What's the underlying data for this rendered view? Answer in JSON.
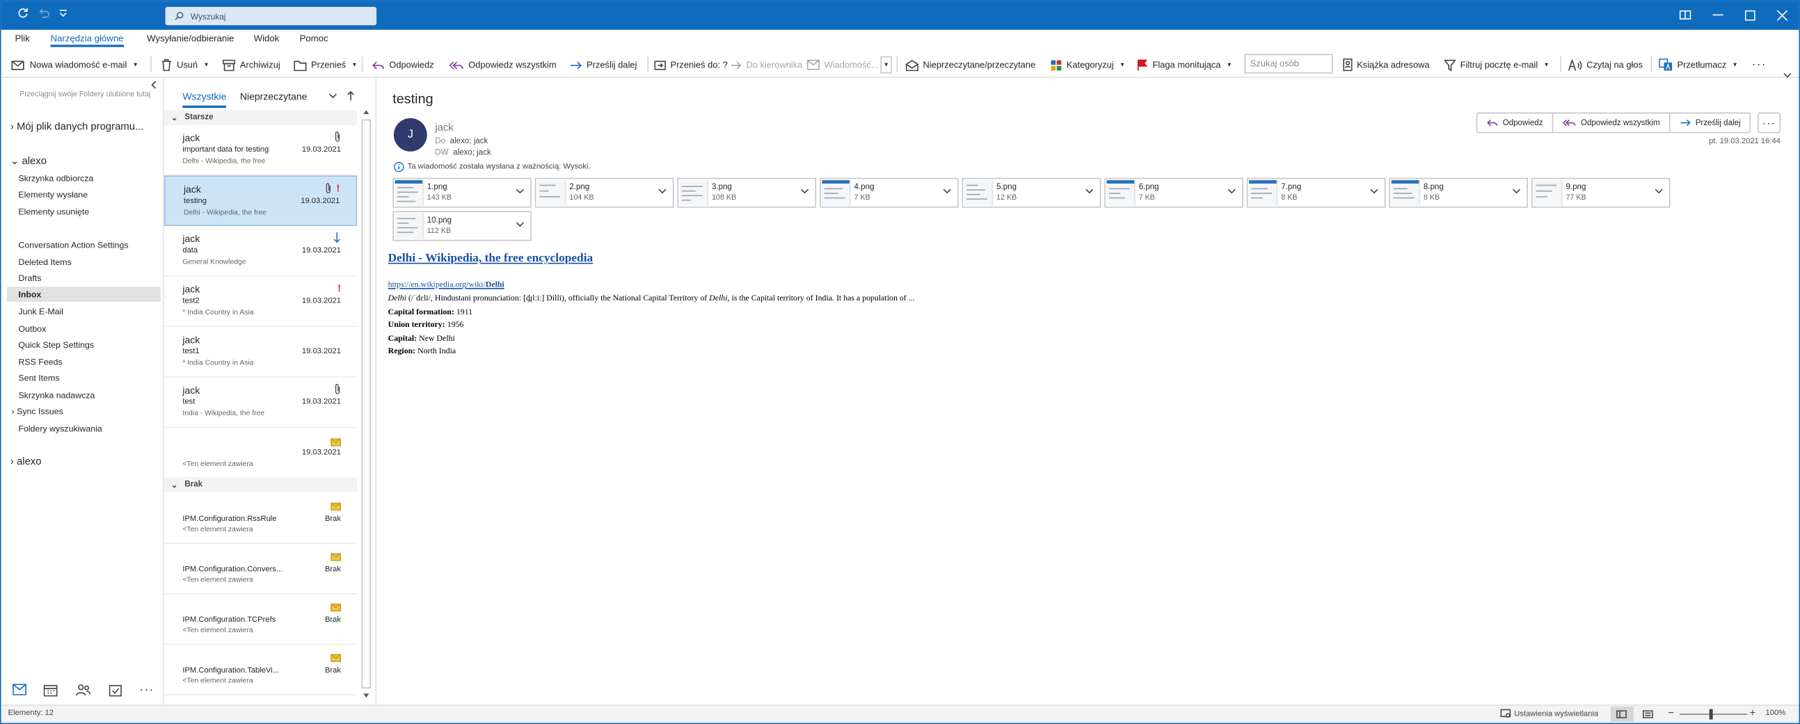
{
  "titlebar": {
    "search_placeholder": "Wyszukaj"
  },
  "tabs": [
    "Plik",
    "Narzędzia główne",
    "Wysyłanie/odbieranie",
    "Widok",
    "Pomoc"
  ],
  "ribbon": {
    "new_email": "Nowa wiadomość e-mail",
    "delete": "Usuń",
    "archive": "Archiwizuj",
    "move": "Przenieś",
    "reply": "Odpowiedz",
    "reply_all": "Odpowiedz wszystkim",
    "forward": "Prześlij dalej",
    "move_to": "Przenieś do: ?",
    "to_manager": "Do kierownika",
    "team_email": "Wiadomość...",
    "unread_read": "Nieprzeczytane/przeczytane",
    "categorize": "Kategoryzuj",
    "follow_up": "Flaga monitująca",
    "search_people": "Szukaj osób",
    "address_book": "Książka adresowa",
    "filter_email": "Filtruj pocztę e-mail",
    "read_aloud": "Czytaj na głos",
    "translate": "Przetłumacz"
  },
  "folders": {
    "fav_hint": "Przeciągnij swoje Foldery ulubione tutaj",
    "my_data_file": "Mój plik danych programu...",
    "account1": "alexo",
    "account1_items": [
      "Skrzynka odbiorcza",
      "Elementy wysłane",
      "Elementy usunięte"
    ],
    "items": [
      "Conversation Action Settings",
      "Deleted Items",
      "Drafts",
      "Inbox",
      "Junk E-Mail",
      "Outbox",
      "Quick Step Settings",
      "RSS Feeds",
      "Sent Items",
      "Skrzynka nadawcza",
      "Sync Issues",
      "Foldery wyszukiwania"
    ],
    "account2": "alexo"
  },
  "list": {
    "filter_all": "Wszystkie",
    "filter_unread": "Nieprzeczytane",
    "group_older": "Starsze",
    "group_none": "Brak",
    "messages": [
      {
        "from": "jack",
        "subject": "important data for testing",
        "preview": "Delhi - Wikipedia, the free",
        "date": "19.03.2021"
      },
      {
        "from": "jack",
        "subject": "testing",
        "preview": "Delhi - Wikipedia, the free",
        "date": "19.03.2021"
      },
      {
        "from": "jack",
        "subject": "data",
        "preview": "General Knowledge",
        "date": "19.03.2021"
      },
      {
        "from": "jack",
        "subject": "test2",
        "preview": "*  India  Country in Asia",
        "date": "19.03.2021"
      },
      {
        "from": "jack",
        "subject": "test1",
        "preview": "*  India  Country in Asia",
        "date": "19.03.2021"
      },
      {
        "from": "jack",
        "subject": "test",
        "preview": "India - Wikipedia, the free",
        "date": "19.03.2021"
      },
      {
        "from": "",
        "subject": "",
        "preview": "<Ten element zawiera",
        "date": "19.03.2021"
      }
    ],
    "system": [
      {
        "from": "IPM.Configuration.RssRule",
        "preview": "<Ten element zawiera",
        "date": "Brak"
      },
      {
        "from": "IPM.Configuration.Convers...",
        "preview": "<Ten element zawiera",
        "date": "Brak"
      },
      {
        "from": "IPM.Configuration.TCPrefs",
        "preview": "<Ten element zawiera",
        "date": "Brak"
      },
      {
        "from": "IPM.Configuration.TableVi...",
        "preview": "<Ten element zawiera",
        "date": "Brak"
      }
    ]
  },
  "reading": {
    "subject": "testing",
    "avatar_initial": "J",
    "sender": "jack",
    "to_label": "Do",
    "to": "alexo; jack",
    "cc_label": "DW",
    "cc": "alexo; jack",
    "importance": "Ta wiadomość została wysłana z ważnością: Wysoki.",
    "reply": "Odpowiedz",
    "reply_all": "Odpowiedz wszystkim",
    "forward": "Prześlij dalej",
    "sent": "pt. 19.03.2021 16:44",
    "attachments": [
      {
        "name": "1.png",
        "size": "143 KB"
      },
      {
        "name": "2.png",
        "size": "104 KB"
      },
      {
        "name": "3.png",
        "size": "108 KB"
      },
      {
        "name": "4.png",
        "size": "7 KB"
      },
      {
        "name": "5.png",
        "size": "12 KB"
      },
      {
        "name": "6.png",
        "size": "7 KB"
      },
      {
        "name": "7.png",
        "size": "8 KB"
      },
      {
        "name": "8.png",
        "size": "8 KB"
      },
      {
        "name": "9.png",
        "size": "77 KB"
      },
      {
        "name": "10.png",
        "size": "112 KB"
      }
    ],
    "body": {
      "title": "Delhi - Wikipedia, the free encyclopedia",
      "url_prefix": "https://en.wikipedia.org/wiki/",
      "url_bold": "Delhi",
      "intro_it": "Delhi",
      "intro_1": " (/ˈdɛli/, Hindustani pronunciation: [d̪ɪlːiː] Dilli), officially the National Capital Territory of ",
      "intro_it2": "Delhi",
      "intro_2": ", is the Capital territory of India. It has a population of ...",
      "facts": [
        {
          "label": "Capital formation:",
          "value": " 1911"
        },
        {
          "label": "Union territory:",
          "value": " 1956"
        },
        {
          "label": "Capital:",
          "value": " New Delhi"
        },
        {
          "label": "Region:",
          "value": " North India"
        }
      ]
    }
  },
  "status": {
    "items": "Elementy: 12",
    "display_settings": "Ustawienia wyświetlania",
    "zoom": "100%"
  }
}
